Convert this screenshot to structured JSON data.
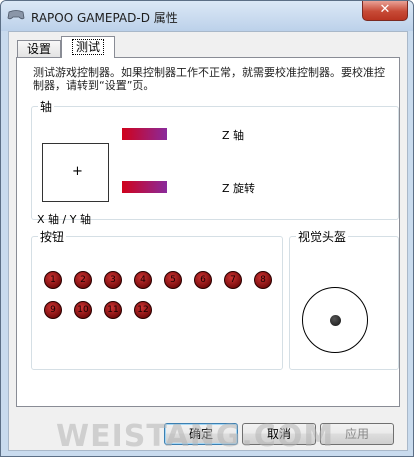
{
  "window": {
    "title": "RAPOO GAMEPAD-D 属性",
    "close_label": "✕"
  },
  "tabs": [
    {
      "label": "设置"
    },
    {
      "label": "测试"
    }
  ],
  "instructions": "测试游戏控制器。如果控制器工作不正常，就需要校准控制器。要校准控制器，请转到“设置”页。",
  "axes": {
    "group_label": "轴",
    "xy_label": "X 轴 / Y 轴",
    "xy_cursor": "+",
    "z_label": "Z 轴",
    "z_rotation_label": "Z 旋转",
    "bar_color_start": "#d0021b",
    "bar_color_end": "#8a2a9c"
  },
  "buttons": {
    "group_label": "按钮",
    "items": [
      "1",
      "2",
      "3",
      "4",
      "5",
      "6",
      "7",
      "8",
      "9",
      "10",
      "11",
      "12"
    ],
    "color": "#7a0d0d"
  },
  "pov": {
    "group_label": "视觉头盔"
  },
  "dialog": {
    "ok_label": "确定",
    "cancel_label": "取消",
    "apply_label": "应用"
  },
  "watermark": "WEISTANG.COM"
}
